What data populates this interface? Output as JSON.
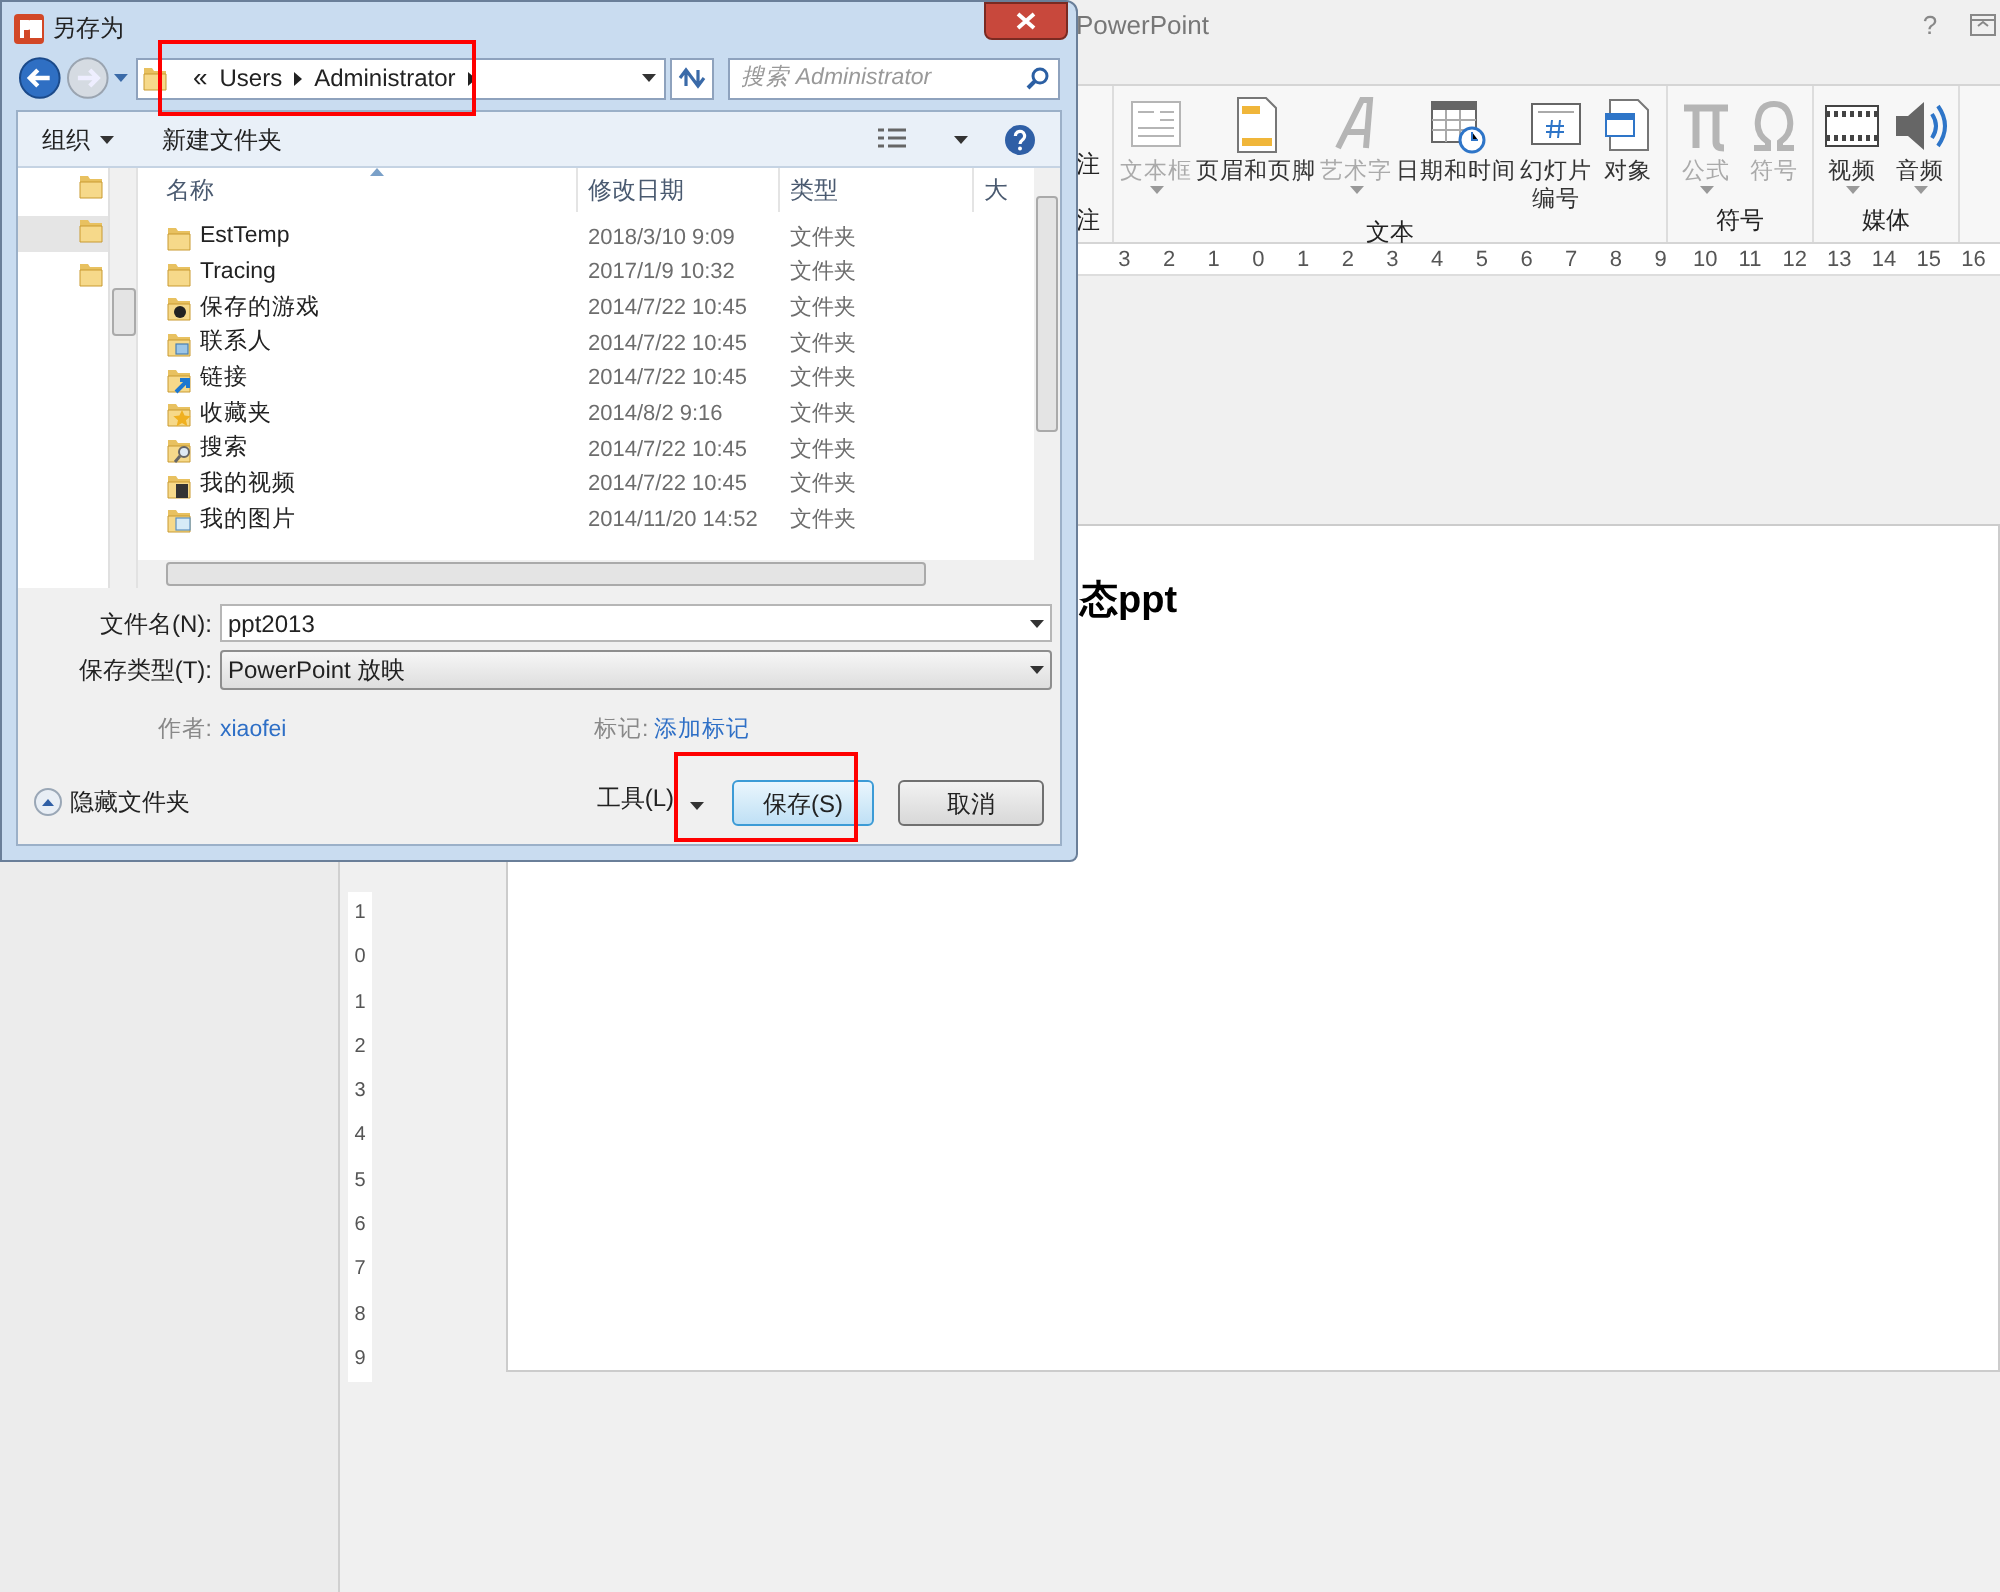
{
  "app": {
    "title": "PowerPoint",
    "help": "?"
  },
  "ribbon": {
    "partial_group": {
      "item": "注",
      "label": "注"
    },
    "groups": [
      {
        "label": "文本",
        "items": [
          {
            "label": "文本框",
            "kind": "textbox",
            "disabled": true,
            "dropdown": true
          },
          {
            "label": "页眉和页脚",
            "kind": "header",
            "disabled": false,
            "dropdown": false
          },
          {
            "label": "艺术字",
            "kind": "wordart",
            "disabled": true,
            "dropdown": true
          },
          {
            "label": "日期和时间",
            "kind": "datetime",
            "disabled": false,
            "dropdown": false
          },
          {
            "label": "幻灯片编号",
            "kind": "slidenumber",
            "disabled": false,
            "dropdown": false
          },
          {
            "label": "对象",
            "kind": "object",
            "disabled": false,
            "dropdown": false
          }
        ]
      },
      {
        "label": "符号",
        "items": [
          {
            "label": "公式",
            "kind": "equation",
            "disabled": true,
            "dropdown": true
          },
          {
            "label": "符号",
            "kind": "symbol",
            "disabled": true,
            "dropdown": false
          }
        ]
      },
      {
        "label": "媒体",
        "items": [
          {
            "label": "视频",
            "kind": "video",
            "disabled": false,
            "dropdown": true
          },
          {
            "label": "音频",
            "kind": "audio",
            "disabled": false,
            "dropdown": true
          }
        ]
      }
    ]
  },
  "ruler": {
    "horizontal": [
      "3",
      "2",
      "1",
      "0",
      "1",
      "2",
      "3",
      "4",
      "5",
      "6",
      "7",
      "8",
      "9",
      "10",
      "11",
      "12",
      "13",
      "14",
      "15",
      "16"
    ],
    "vertical": [
      "1",
      "0",
      "1",
      "2",
      "3",
      "4",
      "5",
      "6",
      "7",
      "8",
      "9"
    ]
  },
  "slide": {
    "text": "态ppt"
  },
  "dialog": {
    "title": "另存为",
    "address": {
      "overflow": "«",
      "items": [
        "Users",
        "Administrator"
      ],
      "highlighted": true
    },
    "search": {
      "placeholder": "搜索 Administrator"
    },
    "toolbar": {
      "organize": "组织",
      "new_folder": "新建文件夹"
    },
    "nav_items": [
      {
        "selected": false
      },
      {
        "selected": true
      },
      {
        "selected": false
      }
    ],
    "columns": [
      "名称",
      "修改日期",
      "类型",
      "大"
    ],
    "rows": [
      {
        "name": "EstTemp",
        "date": "2018/3/10 9:09",
        "type": "文件夹",
        "kind": "folder"
      },
      {
        "name": "Tracing",
        "date": "2017/1/9 10:32",
        "type": "文件夹",
        "kind": "folder"
      },
      {
        "name": "保存的游戏",
        "date": "2014/7/22 10:45",
        "type": "文件夹",
        "kind": "games"
      },
      {
        "name": "联系人",
        "date": "2014/7/22 10:45",
        "type": "文件夹",
        "kind": "contacts"
      },
      {
        "name": "链接",
        "date": "2014/7/22 10:45",
        "type": "文件夹",
        "kind": "links"
      },
      {
        "name": "收藏夹",
        "date": "2014/8/2 9:16",
        "type": "文件夹",
        "kind": "favorites"
      },
      {
        "name": "搜索",
        "date": "2014/7/22 10:45",
        "type": "文件夹",
        "kind": "searches"
      },
      {
        "name": "我的视频",
        "date": "2014/7/22 10:45",
        "type": "文件夹",
        "kind": "videos"
      },
      {
        "name": "我的图片",
        "date": "2014/11/20 14:52",
        "type": "文件夹",
        "kind": "pictures"
      }
    ],
    "file_name": {
      "label": "文件名(N):",
      "value": "ppt2013"
    },
    "save_type": {
      "label": "保存类型(T):",
      "value": "PowerPoint 放映"
    },
    "author": {
      "label": "作者:",
      "value": "xiaofei"
    },
    "tags": {
      "label": "标记:",
      "value": "添加标记"
    },
    "hide_folders": "隐藏文件夹",
    "tools": "工具(L)",
    "save": {
      "label": "保存(S)",
      "highlighted": true
    },
    "cancel": "取消"
  }
}
